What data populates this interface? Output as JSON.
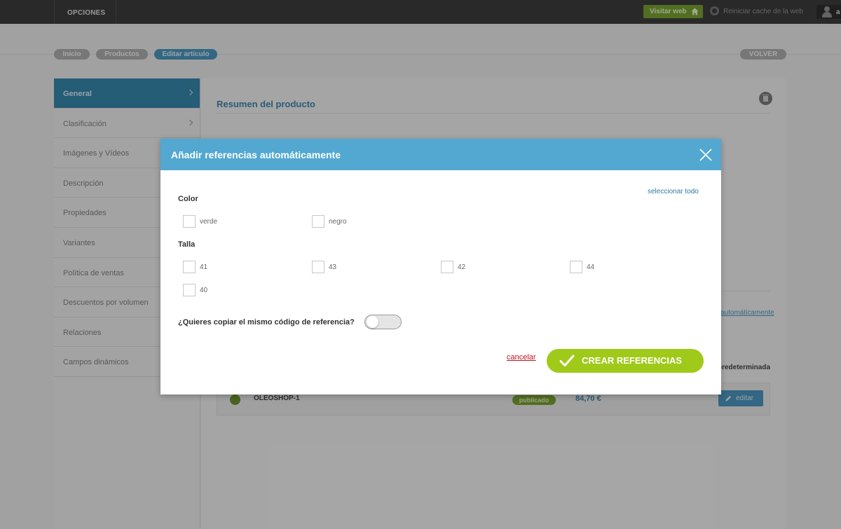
{
  "topbar": {
    "menu_label": "OPCIONES",
    "visit_label": "Visitar web",
    "cache_label": "Reiniciar cache de la web",
    "user_initial": "a"
  },
  "breadcrumb": [
    {
      "label": "Inicio"
    },
    {
      "label": "Productos"
    },
    {
      "label": "Editar artículo"
    }
  ],
  "back_label": "VOLVER",
  "sidebar": {
    "items": [
      {
        "label": "General"
      },
      {
        "label": "Clasificación"
      },
      {
        "label": "Imágenes y Vídeos"
      },
      {
        "label": "Descripción"
      },
      {
        "label": "Propiedades"
      },
      {
        "label": "Variantes"
      },
      {
        "label": "Política de ventas"
      },
      {
        "label": "Descuentos por volumen"
      },
      {
        "label": "Relaciones"
      },
      {
        "label": "Campos dinámicos"
      }
    ]
  },
  "content": {
    "summary_title": "Resumen del producto",
    "auto_link": "automáticamente",
    "default_label": "predeterminada",
    "reference": {
      "name": "OLEOSHOP-1",
      "status": "publicado",
      "price": "84,70 €",
      "edit_label": "editar"
    }
  },
  "modal": {
    "title": "Añadir referencias automáticamente",
    "select_all": "seleccionar todo",
    "color_label": "Color",
    "colors": [
      "verde",
      "negro"
    ],
    "size_label": "Talla",
    "sizes": [
      "41",
      "43",
      "42",
      "44",
      "40"
    ],
    "copy_question": "¿Quieres copiar el mismo código de referencia?",
    "copy_toggle_on": false,
    "cancel_label": "cancelar",
    "create_label": "CREAR REFERENCIAS"
  },
  "colors": {
    "accent": "#52a8d0",
    "sidebar_active": "#247ca7",
    "create_button": "#9fca1a",
    "cancel_link": "#c0141e",
    "published": "#6c9a1e"
  }
}
